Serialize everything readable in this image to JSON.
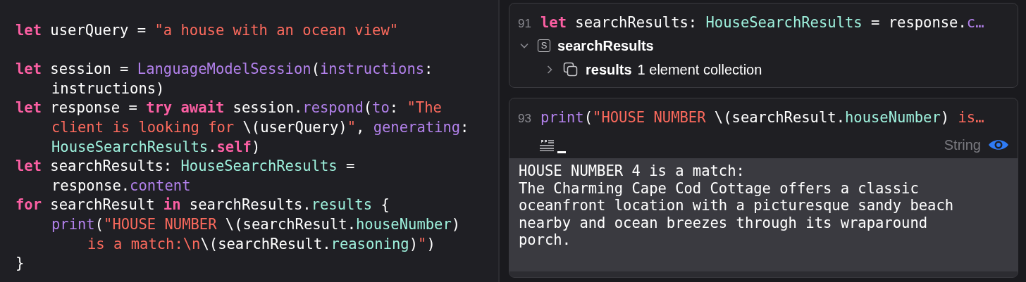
{
  "editor": {
    "lines": [
      {
        "kind": "top",
        "tokens": [
          {
            "kind": "kw",
            "text": "let"
          },
          {
            "kind": "plain",
            "text": " userQuery = "
          },
          {
            "kind": "str",
            "text": "\"a house with an ocean view\""
          }
        ]
      },
      {
        "kind": "blank"
      },
      {
        "kind": "top",
        "tokens": [
          {
            "kind": "kw",
            "text": "let"
          },
          {
            "kind": "plain",
            "text": " session = "
          },
          {
            "kind": "fn",
            "text": "LanguageModelSession"
          },
          {
            "kind": "plain",
            "text": "("
          },
          {
            "kind": "fn",
            "text": "instructions"
          },
          {
            "kind": "plain",
            "text": ":"
          }
        ]
      },
      {
        "kind": "wrap",
        "tokens": [
          {
            "kind": "plain",
            "text": "instructions)"
          }
        ]
      },
      {
        "kind": "top",
        "tokens": [
          {
            "kind": "kw",
            "text": "let"
          },
          {
            "kind": "plain",
            "text": " response = "
          },
          {
            "kind": "kw",
            "text": "try await"
          },
          {
            "kind": "plain",
            "text": " session."
          },
          {
            "kind": "fn",
            "text": "respond"
          },
          {
            "kind": "plain",
            "text": "("
          },
          {
            "kind": "fn",
            "text": "to"
          },
          {
            "kind": "plain",
            "text": ": "
          },
          {
            "kind": "str",
            "text": "\"The"
          }
        ]
      },
      {
        "kind": "wrap",
        "tokens": [
          {
            "kind": "str",
            "text": "client is looking for "
          },
          {
            "kind": "plain",
            "text": "\\(userQuery)"
          },
          {
            "kind": "str",
            "text": "\""
          },
          {
            "kind": "plain",
            "text": ", "
          },
          {
            "kind": "fn",
            "text": "generating"
          },
          {
            "kind": "plain",
            "text": ":"
          }
        ]
      },
      {
        "kind": "wrap",
        "tokens": [
          {
            "kind": "type",
            "text": "HouseSearchResults"
          },
          {
            "kind": "plain",
            "text": "."
          },
          {
            "kind": "kw",
            "text": "self"
          },
          {
            "kind": "plain",
            "text": ")"
          }
        ]
      },
      {
        "kind": "top",
        "tokens": [
          {
            "kind": "kw",
            "text": "let"
          },
          {
            "kind": "plain",
            "text": " searchResults: "
          },
          {
            "kind": "type",
            "text": "HouseSearchResults"
          },
          {
            "kind": "plain",
            "text": " ="
          }
        ]
      },
      {
        "kind": "wrap",
        "tokens": [
          {
            "kind": "plain",
            "text": "response."
          },
          {
            "kind": "fn",
            "text": "content"
          }
        ]
      },
      {
        "kind": "top",
        "tokens": [
          {
            "kind": "kw",
            "text": "for"
          },
          {
            "kind": "plain",
            "text": " searchResult "
          },
          {
            "kind": "kw",
            "text": "in"
          },
          {
            "kind": "plain",
            "text": " searchResults."
          },
          {
            "kind": "type",
            "text": "results"
          },
          {
            "kind": "plain",
            "text": " {"
          }
        ]
      },
      {
        "kind": "body",
        "tokens": [
          {
            "kind": "fn",
            "text": "print"
          },
          {
            "kind": "plain",
            "text": "("
          },
          {
            "kind": "str",
            "text": "\"HOUSE NUMBER "
          },
          {
            "kind": "plain",
            "text": "\\(searchResult."
          },
          {
            "kind": "type",
            "text": "houseNumber"
          },
          {
            "kind": "plain",
            "text": ")"
          }
        ]
      },
      {
        "kind": "body_wrap",
        "tokens": [
          {
            "kind": "str",
            "text": "is a match:\\n"
          },
          {
            "kind": "plain",
            "text": "\\(searchResult."
          },
          {
            "kind": "type",
            "text": "reasoning"
          },
          {
            "kind": "plain",
            "text": ")"
          },
          {
            "kind": "str",
            "text": "\""
          },
          {
            "kind": "plain",
            "text": ")"
          }
        ]
      },
      {
        "kind": "top",
        "tokens": [
          {
            "kind": "plain",
            "text": "}"
          }
        ]
      }
    ]
  },
  "results_panel": {
    "cards": [
      {
        "line_number": "91",
        "tokens": [
          {
            "kind": "kw",
            "text": "let"
          },
          {
            "kind": "plain",
            "text": " searchResults: "
          },
          {
            "kind": "type",
            "text": "HouseSearchResults"
          },
          {
            "kind": "plain",
            "text": " = response."
          },
          {
            "kind": "fn",
            "text": "c…"
          }
        ],
        "tree": [
          {
            "name": "searchResults",
            "badge": "S",
            "expanded": true,
            "children": [
              {
                "name": "results",
                "summary": "1 element collection",
                "expanded": false
              }
            ]
          }
        ]
      },
      {
        "line_number": "93",
        "tokens": [
          {
            "kind": "fn",
            "text": "print"
          },
          {
            "kind": "plain",
            "text": "("
          },
          {
            "kind": "str",
            "text": "\"HOUSE NUMBER "
          },
          {
            "kind": "plain",
            "text": "\\(searchResult."
          },
          {
            "kind": "type",
            "text": "houseNumber"
          },
          {
            "kind": "plain",
            "text": ") "
          },
          {
            "kind": "str",
            "text": "is…"
          }
        ],
        "value_type": "String",
        "output": "HOUSE NUMBER 4 is a match:\nThe Charming Cape Cod Cottage offers a classic\noceanfront location with a picturesque sandy beach\nnearby and ocean breezes through its wraparound\nporch."
      }
    ]
  }
}
